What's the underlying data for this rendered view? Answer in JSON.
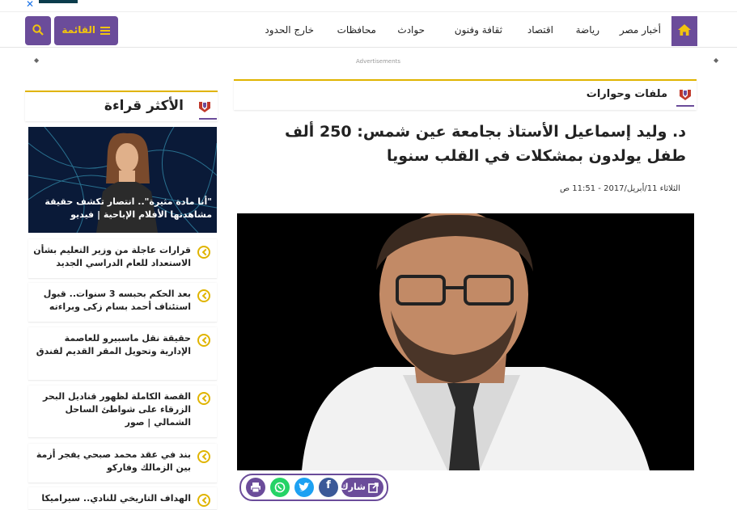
{
  "topad": {
    "close_glyph": "✕"
  },
  "nav": {
    "links": [
      "أخبار مصر",
      "رياضة",
      "اقتصاد",
      "ثقافة وفنون",
      "حوادث",
      "محافظات",
      "خارج الحدود"
    ],
    "menu_label": "القائمة",
    "accent": "#6b4c9a",
    "gold": "#f1c40f"
  },
  "ad": {
    "label": "Advertisements",
    "arrow": "◆"
  },
  "sidebar": {
    "title": "الأكثر قراءة",
    "featured": {
      "caption": "\"أنا مادة مثيرة\".. انتصار تكشف حقيقة مشاهدتها الأفلام الإباحية | فيديو"
    },
    "items": [
      {
        "text": "قرارات عاجلة من وزير التعليم بشأن الاستعداد للعام الدراسي الجديد"
      },
      {
        "text": "بعد الحكم بحبسه 3 سنوات.. قبول استئناف أحمد بسام زكى وبراءته"
      },
      {
        "text": "حقيقة نقل ماسبيرو للعاصمة الإدارية وتحويل المقر القديم لفندق"
      },
      {
        "text": "القصة الكاملة لظهور قناديل البحر الزرقاء على شواطئ الساحل الشمالي | صور"
      },
      {
        "text": "بند في عقد محمد صبحي يفجر أزمة بين الزمالك وفاركو"
      },
      {
        "text": "الهداف التاريخي للنادي.. سيراميكا"
      }
    ]
  },
  "article": {
    "section": "ملفات وحوارات",
    "title": "د. وليد إسماعيل الأستاذ بجامعة عين شمس: 250 ألف طفل يولدون بمشكلات في القلب سنويا",
    "date": "الثلاثاء 11/أبريل/2017 - 11:51 ص",
    "share_label": "شارك",
    "share_icons": [
      "facebook-icon",
      "twitter-icon",
      "whatsapp-icon",
      "print-icon"
    ],
    "share_colors": {
      "facebook": "#3b5998",
      "twitter": "#1da1f2",
      "whatsapp": "#25d366",
      "print": "#6b4c9a"
    }
  }
}
